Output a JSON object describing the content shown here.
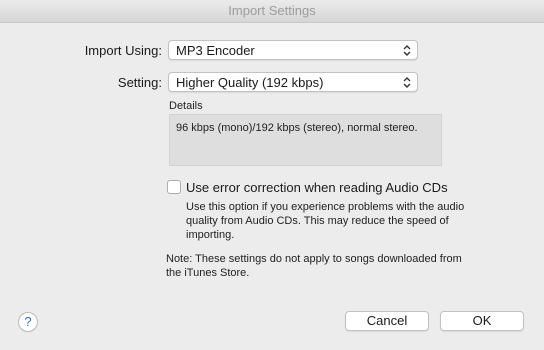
{
  "window": {
    "title": "Import Settings"
  },
  "import_using": {
    "label": "Import Using:",
    "value": "MP3 Encoder",
    "icon": "chevron-up-down-icon"
  },
  "setting": {
    "label": "Setting:",
    "value": "Higher Quality (192 kbps)",
    "icon": "chevron-up-down-icon"
  },
  "details": {
    "label": "Details",
    "text": "96 kbps (mono)/192 kbps (stereo), normal stereo."
  },
  "error_correction": {
    "label": "Use error correction when reading Audio CDs",
    "checked": false,
    "help": "Use this option if you experience problems with the audio quality from Audio CDs.  This may reduce the speed of importing."
  },
  "note": "Note: These settings do not apply to songs downloaded from the iTunes Store.",
  "buttons": {
    "help": "?",
    "cancel": "Cancel",
    "ok": "OK"
  },
  "colors": {
    "help_accent": "#2a6bd6",
    "background": "#ececec"
  }
}
